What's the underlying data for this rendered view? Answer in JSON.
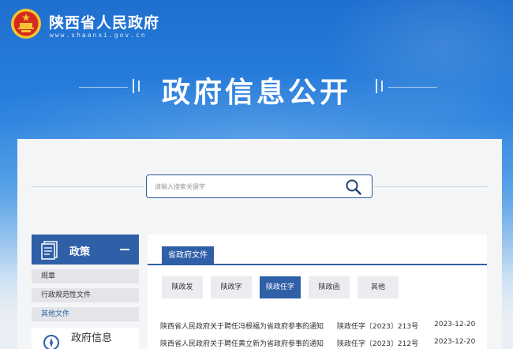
{
  "header": {
    "site_name": "陕西省人民政府",
    "site_url": "www.shaanxi.gov.cn",
    "page_title": "政府信息公开"
  },
  "search": {
    "placeholder": "请输入搜索关键字"
  },
  "sidebar": {
    "section_label": "政策",
    "items": [
      {
        "label": "规章"
      },
      {
        "label": "行政规范性文件"
      },
      {
        "label": "其他文件"
      }
    ],
    "next_section_label": "政府信息"
  },
  "content": {
    "tab_label": "省政府文件",
    "filters": [
      {
        "label": "陕政发"
      },
      {
        "label": "陕政字"
      },
      {
        "label": "陕政任字"
      },
      {
        "label": "陕政函"
      },
      {
        "label": "其他"
      }
    ],
    "active_filter": "陕政任字",
    "rows": [
      {
        "title": "陕西省人民政府关于聘任冯根福为省政府参事的通知",
        "number": "陕政任字〔2023〕213号",
        "date": "2023-12-20"
      },
      {
        "title": "陕西省人民政府关于聘任黄立新为省政府参事的通知",
        "number": "陕政任字〔2023〕212号",
        "date": "2023-12-20"
      }
    ]
  },
  "colors": {
    "primary_blue": "#2f5fa7",
    "emblem_red": "#d62a1e",
    "emblem_gold": "#f4c430"
  }
}
